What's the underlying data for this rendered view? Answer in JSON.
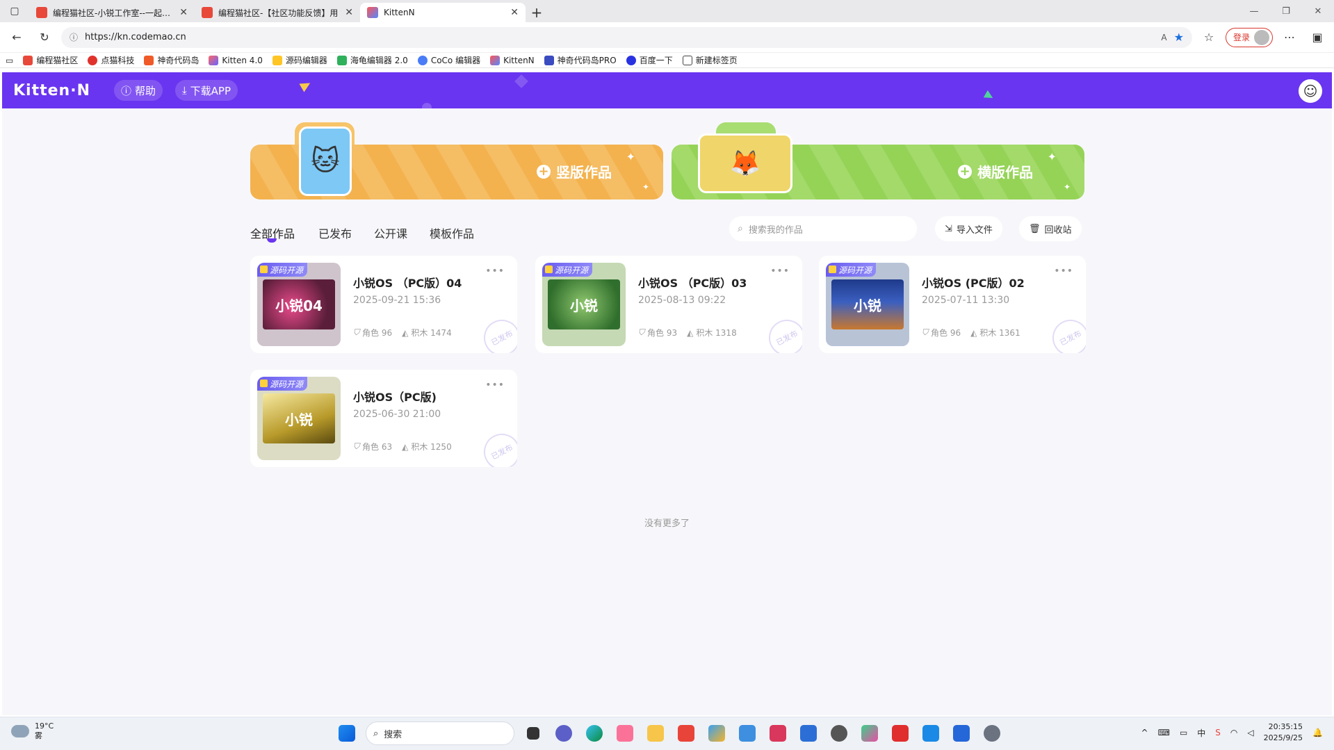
{
  "browser": {
    "tabs": [
      {
        "title": "编程猫社区-小锐工作室--一起学编"
      },
      {
        "title": "编程猫社区-【社区功能反馈】用"
      },
      {
        "title": "KittenN"
      }
    ],
    "url": "https://kn.codemao.cn",
    "login_label": "登录",
    "bookmarks": [
      "编程猫社区",
      "点猫科技",
      "神奇代码岛",
      "Kitten 4.0",
      "源码编辑器",
      "海龟编辑器 2.0",
      "CoCo 编辑器",
      "KittenN",
      "神奇代码岛PRO",
      "百度一下",
      "新建标签页"
    ]
  },
  "header": {
    "logo": "Kitten·N",
    "help_label": "帮助",
    "download_label": "下载APP"
  },
  "banners": {
    "vertical_label": "竖版作品",
    "horizontal_label": "横版作品"
  },
  "filters": {
    "tabs": [
      "全部作品",
      "已发布",
      "公开课",
      "模板作品"
    ],
    "search_placeholder": "搜索我的作品",
    "import_label": "导入文件",
    "recycle_label": "回收站"
  },
  "works": [
    {
      "badge": "源码开源",
      "title": "小锐OS （PC版）04",
      "date": "2025-09-21 15:36",
      "roles_label": "角色 96",
      "blocks_label": "积木 1474",
      "cover_text": "小锐04",
      "stamp": "已发布"
    },
    {
      "badge": "源码开源",
      "title": "小锐OS （PC版）03",
      "date": "2025-08-13 09:22",
      "roles_label": "角色 93",
      "blocks_label": "积木 1318",
      "cover_text": "小锐",
      "stamp": "已发布"
    },
    {
      "badge": "源码开源",
      "title": "小锐OS (PC版）02",
      "date": "2025-07-11 13:30",
      "roles_label": "角色 96",
      "blocks_label": "积木 1361",
      "cover_text": "小锐",
      "stamp": "已发布"
    },
    {
      "badge": "源码开源",
      "title": "小锐OS（PC版)",
      "date": "2025-06-30 21:00",
      "roles_label": "角色 63",
      "blocks_label": "积木 1250",
      "cover_text": "小锐",
      "stamp": "已发布"
    }
  ],
  "no_more": "没有更多了",
  "taskbar": {
    "temp": "19°C",
    "weather": "雾",
    "search_label": "搜索",
    "time": "20:35:15",
    "date": "2025/9/25"
  },
  "colors": {
    "brand": "#6a35f0",
    "vertical_banner": "#f3b24e",
    "horizontal_banner": "#95d357"
  }
}
